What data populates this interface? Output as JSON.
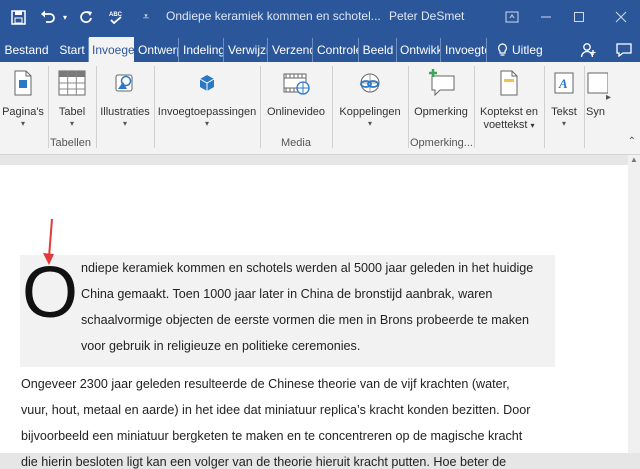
{
  "app": {
    "title": "Ondiepe keramiek kommen en schotel...",
    "user": "Peter DeSmet"
  },
  "tabs": [
    {
      "label": "Bestand"
    },
    {
      "label": "Start"
    },
    {
      "label": "Invoegen"
    },
    {
      "label": "Ontwerp"
    },
    {
      "label": "Indeling"
    },
    {
      "label": "Verwijzingen"
    },
    {
      "label": "Verzendlijsten"
    },
    {
      "label": "Controleren"
    },
    {
      "label": "Beeld"
    },
    {
      "label": "Ontwikkelaars"
    },
    {
      "label": "Invoegtoepassingen"
    }
  ],
  "tell_me": {
    "label": "Uitleg"
  },
  "ribbon": {
    "buttons": {
      "paginas": "Pagina's",
      "tabel": "Tabel",
      "illustraties": "Illustraties",
      "invoegtoepassingen": "Invoegtoepassingen",
      "onlinevideo": "Onlinevideo",
      "koppelingen": "Koppelingen",
      "opmerking": "Opmerking",
      "koptekst_1": "Koptekst en",
      "koptekst_2": "voettekst",
      "tekst": "Tekst",
      "symbolen": "Syn"
    },
    "groups": {
      "tabellen": "Tabellen",
      "media": "Media",
      "opmerkingen": "Opmerking..."
    }
  },
  "document": {
    "dropcap": "O",
    "para1": [
      "ndiepe keramiek kommen en schotels werden al 5000 jaar geleden in het huidige",
      "China gemaakt. Toen 1000 jaar later in China de bronstijd aanbrak, waren",
      "schaalvormige objecten de eerste vormen die men in Brons probeerde te maken",
      "voor gebruik in religieuze en politieke ceremonies."
    ],
    "para2": [
      "Ongeveer 2300 jaar geleden resulteerde de Chinese theorie van de vijf krachten (water,",
      "vuur, hout, metaal en aarde) in het idee dat miniatuur replica’s kracht konden bezitten. Door",
      "bijvoorbeeld een miniatuur bergketen te maken en te concentreren op de magische kracht",
      "die hierin besloten ligt kan een volger van de theorie hieruit kracht putten. Hoe beter de"
    ]
  },
  "colors": {
    "word_blue": "#2b579a",
    "annotation_arrow": "#e03a3a"
  }
}
